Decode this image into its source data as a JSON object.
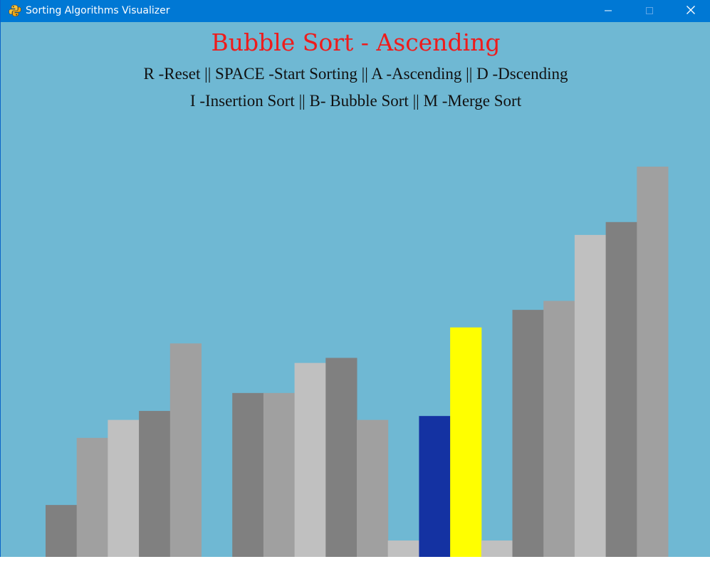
{
  "window": {
    "title": "Sorting Algorithms Visualizer",
    "app_icon": "python-snake-icon",
    "controls": {
      "minimize": "minimize-icon",
      "maximize": "maximize-icon",
      "close": "close-icon"
    }
  },
  "visualizer": {
    "heading": "Bubble Sort - Ascending",
    "controls_line_1": "R -Reset || SPACE -Start Sorting || A -Ascending || D -Dscending",
    "controls_line_2": "I -Insertion Sort || B- Bubble Sort || M -Merge Sort",
    "background_color": "#6fb8d3",
    "heading_color": "#ee1c1c",
    "highlight_colors": {
      "compare_low": "#1432a2",
      "compare_high": "#ffff00"
    },
    "gray_shades": [
      "#808080",
      "#a0a0a0",
      "#c0c0c0"
    ]
  },
  "chart_data": {
    "type": "bar",
    "title": "",
    "xlabel": "",
    "ylabel": "",
    "ylim": [
      0,
      100
    ],
    "values": [
      13.3,
      30.5,
      35.1,
      37.4,
      54.7,
      0,
      42.0,
      42.0,
      49.7,
      51.0,
      35.1,
      4.2,
      36.1,
      58.8,
      4.2,
      63.3,
      65.6,
      82.5,
      85.8,
      100
    ],
    "bar_states": [
      "default",
      "default",
      "default",
      "default",
      "default",
      "default",
      "default",
      "default",
      "default",
      "default",
      "default",
      "default",
      "compare_low",
      "compare_high",
      "default",
      "default",
      "default",
      "default",
      "default",
      "default"
    ]
  }
}
